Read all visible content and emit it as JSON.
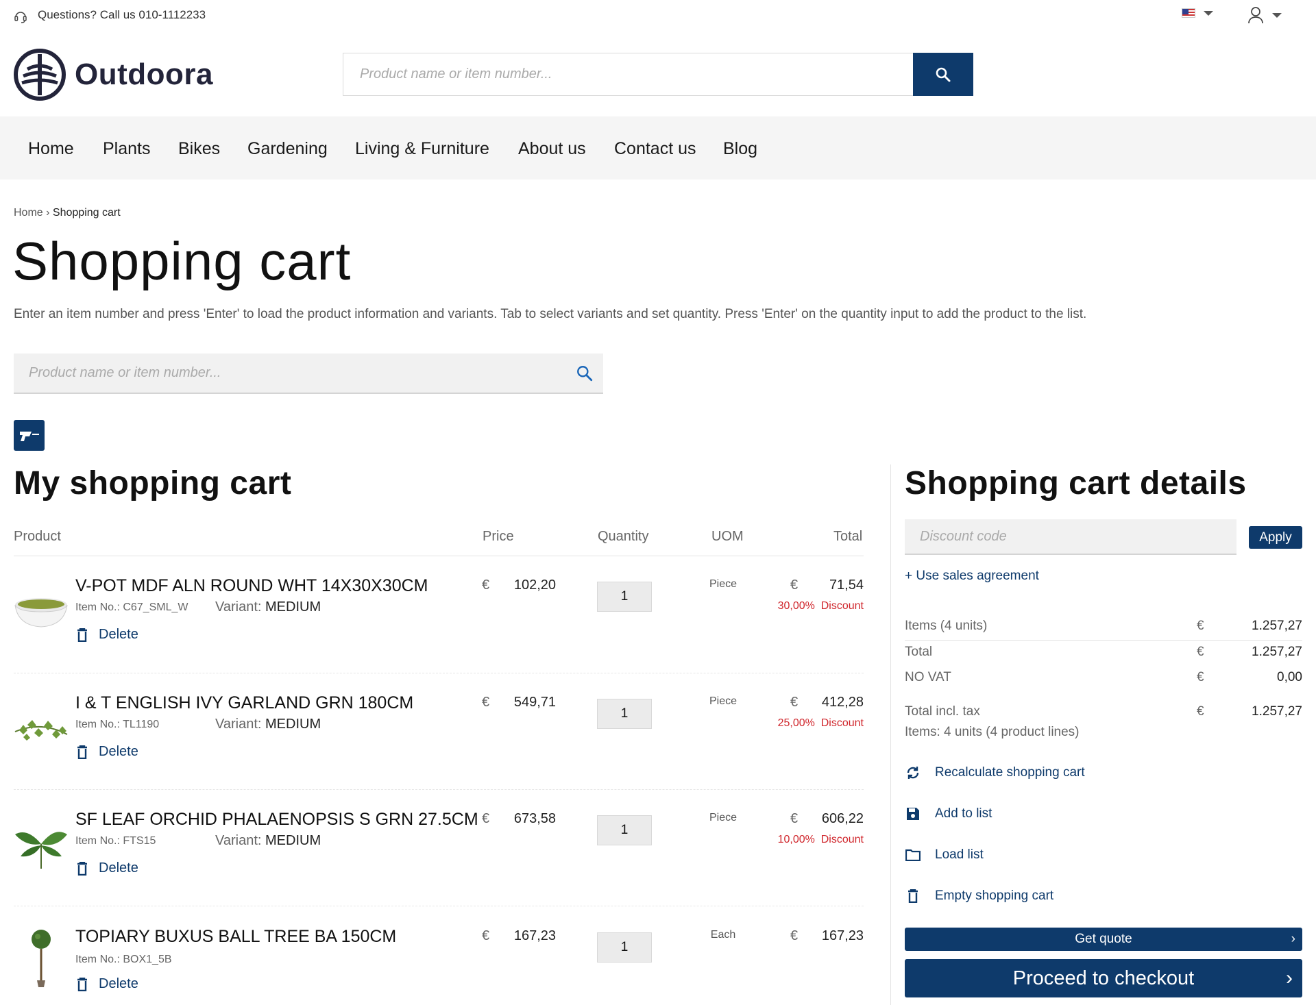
{
  "topbar": {
    "contact": "Questions? Call us 010-1112233"
  },
  "brand": {
    "name": "Outdoora",
    "color": "#0e3a6b"
  },
  "search": {
    "placeholder": "Product name or item number..."
  },
  "nav": {
    "items": [
      "Home",
      "Plants",
      "Bikes",
      "Gardening",
      "Living & Furniture",
      "About us",
      "Contact us",
      "Blog"
    ]
  },
  "breadcrumb": {
    "home": "Home",
    "separator": "›",
    "current": "Shopping cart"
  },
  "page": {
    "title": "Shopping cart",
    "intro": "Enter an item number and press 'Enter' to load the product information and variants. Tab to select variants and set quantity. Press 'Enter' on the quantity input to add the product to the list."
  },
  "cart_search": {
    "placeholder": "Product name or item number..."
  },
  "cart": {
    "title": "My shopping cart",
    "columns": {
      "product": "Product",
      "price": "Price",
      "quantity": "Quantity",
      "uom": "UOM",
      "total": "Total"
    },
    "currency": "€",
    "item_no_label": "Item No.:",
    "variant_label": "Variant:",
    "delete_label": "Delete",
    "discount_label": "Discount",
    "items": [
      {
        "name": "V-POT MDF ALN ROUND WHT 14X30X30CM",
        "item_no": "C67_SML_W",
        "variant": "MEDIUM",
        "price": "102,20",
        "quantity": "1",
        "uom": "Piece",
        "total": "71,54",
        "discount": "30,00%",
        "image": "white-pot-icon"
      },
      {
        "name": "I & T ENGLISH IVY GARLAND GRN 180CM",
        "item_no": "TL1190",
        "variant": "MEDIUM",
        "price": "549,71",
        "quantity": "1",
        "uom": "Piece",
        "total": "412,28",
        "discount": "25,00%",
        "image": "ivy-icon"
      },
      {
        "name": "SF LEAF ORCHID PHALAENOPSIS S GRN 27.5CM",
        "item_no": "FTS15",
        "variant": "MEDIUM",
        "price": "673,58",
        "quantity": "1",
        "uom": "Piece",
        "total": "606,22",
        "discount": "10,00%",
        "image": "orchid-leaf-icon"
      },
      {
        "name": "TOPIARY BUXUS BALL TREE BA 150CM",
        "item_no": "BOX1_5B",
        "variant": "",
        "price": "167,23",
        "quantity": "1",
        "uom": "Each",
        "total": "167,23",
        "discount": "",
        "image": "topiary-icon"
      }
    ]
  },
  "details": {
    "title": "Shopping cart details",
    "discount_placeholder": "Discount code",
    "apply_label": "Apply",
    "sales_agreement": "+ Use sales agreement",
    "currency": "€",
    "items_label": "Items (4 units)",
    "items_value": "1.257,27",
    "total_label": "Total",
    "total_value": "1.257,27",
    "vat_label": "NO VAT",
    "vat_value": "0,00",
    "incl_label": "Total incl. tax",
    "incl_value": "1.257,27",
    "summary": "Items: 4 units (4 product lines)",
    "actions": {
      "recalculate": "Recalculate shopping cart",
      "add_list": "Add to list",
      "load_list": "Load list",
      "empty": "Empty shopping cart"
    },
    "quote_label": "Get quote",
    "checkout_label": "Proceed to checkout",
    "chevron": "›"
  },
  "colors": {
    "primary": "#0e3a6b",
    "discount": "#d0262c",
    "nav_bg": "#f5f5f5"
  }
}
